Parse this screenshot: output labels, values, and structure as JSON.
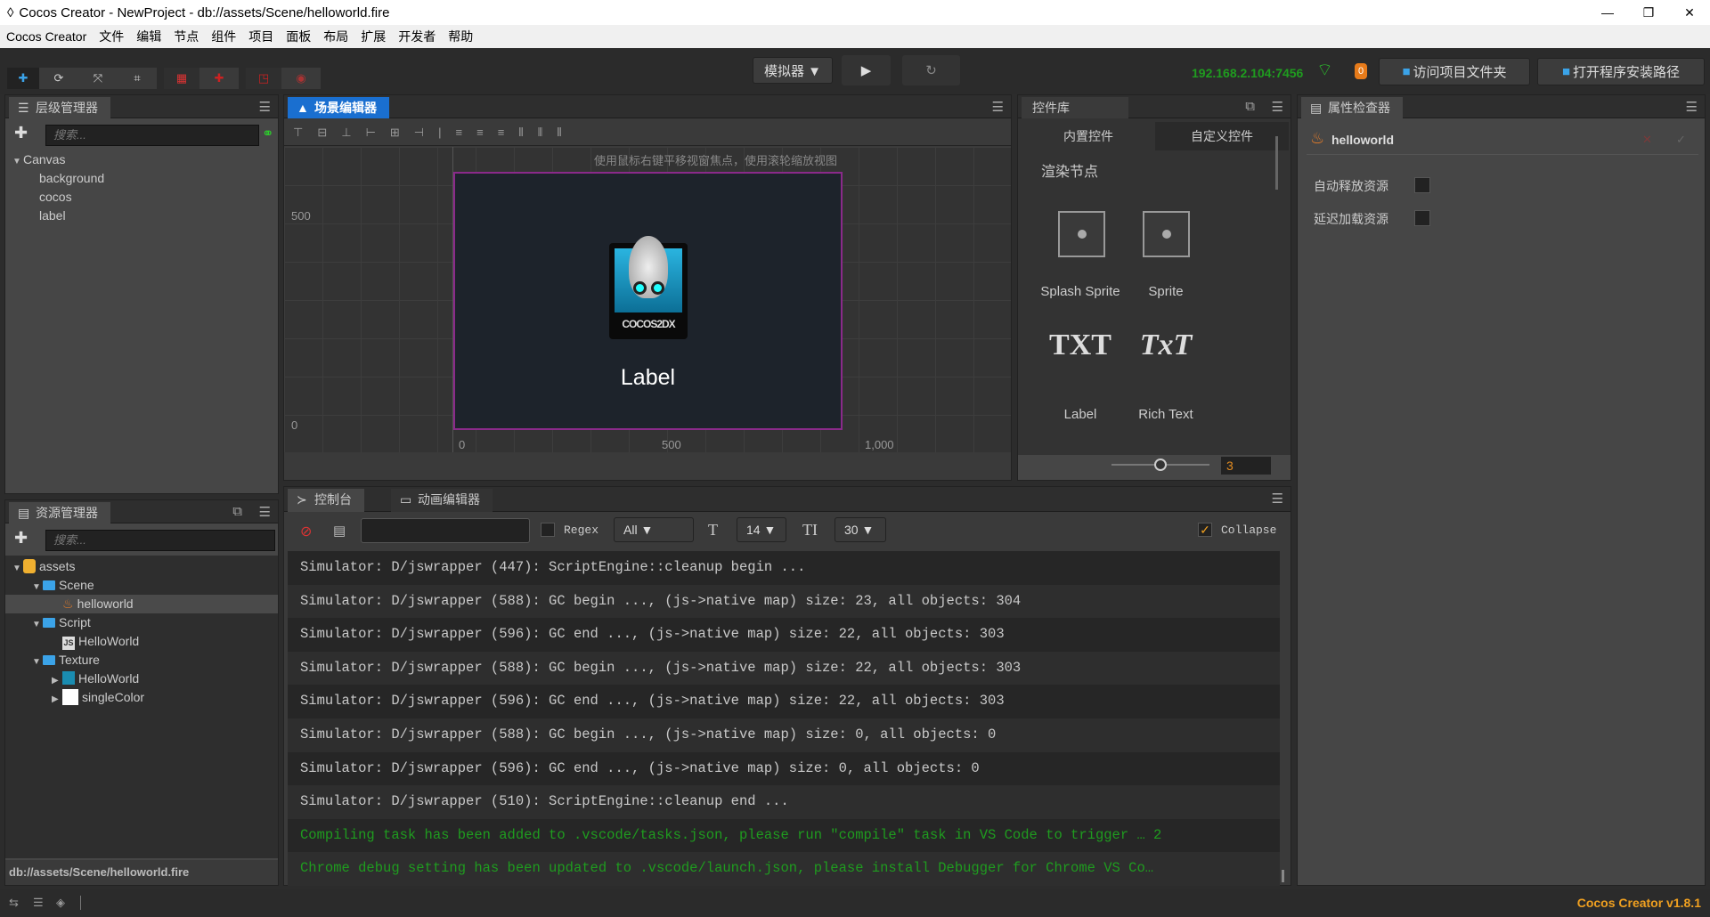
{
  "window": {
    "title": "Cocos Creator - NewProject - db://assets/Scene/helloworld.fire",
    "minimize": "—",
    "maximize": "❐",
    "close": "✕"
  },
  "menu": [
    "Cocos Creator",
    "文件",
    "编辑",
    "节点",
    "组件",
    "项目",
    "面板",
    "布局",
    "扩展",
    "开发者",
    "帮助"
  ],
  "toolbar": {
    "simulator": "模拟器 ▼",
    "play": "▶",
    "refresh": "↻",
    "ip": "192.168.2.104:7456",
    "badge": "0",
    "open_project": "访问项目文件夹",
    "open_install": "打开程序安装路径",
    "accent": "#1f9c1f"
  },
  "hierarchy": {
    "title": "层级管理器",
    "search_placeholder": "搜索...",
    "root": "Canvas",
    "children": [
      "background",
      "cocos",
      "label"
    ]
  },
  "assets": {
    "title": "资源管理器",
    "search_placeholder": "搜索...",
    "tree": [
      {
        "label": "assets",
        "depth": 0,
        "type": "db",
        "arrow": "▼"
      },
      {
        "label": "Scene",
        "depth": 1,
        "type": "folder",
        "arrow": "▼"
      },
      {
        "label": "helloworld",
        "depth": 2,
        "type": "fire",
        "arrow": "",
        "selected": true
      },
      {
        "label": "Script",
        "depth": 1,
        "type": "folder",
        "arrow": "▼"
      },
      {
        "label": "HelloWorld",
        "depth": 2,
        "type": "js",
        "arrow": ""
      },
      {
        "label": "Texture",
        "depth": 1,
        "type": "folder",
        "arrow": "▼"
      },
      {
        "label": "HelloWorld",
        "depth": 2,
        "type": "image",
        "arrow": "▶"
      },
      {
        "label": "singleColor",
        "depth": 2,
        "type": "white",
        "arrow": "▶"
      }
    ],
    "path": "db://assets/Scene/helloworld.fire"
  },
  "scene": {
    "title": "场景编辑器",
    "hint": "使用鼠标右键平移视窗焦点，使用滚轮缩放视图",
    "y_ticks": [
      "500",
      "0"
    ],
    "x_ticks": [
      "0",
      "500",
      "1,000"
    ],
    "label_text": "Label",
    "logo_text": "COCOS2DX",
    "frame_color": "#8a2a8a"
  },
  "library": {
    "title": "控件库",
    "tabs": [
      "内置控件",
      "自定义控件"
    ],
    "section": "渲染节点",
    "items": [
      {
        "label": "Splash Sprite",
        "icon": "sprite-icon"
      },
      {
        "label": "Sprite",
        "icon": "sprite-icon"
      },
      {
        "label": "Label",
        "icon_text": "TXT"
      },
      {
        "label": "Rich Text",
        "icon_text": "TxT"
      }
    ],
    "size_value": "3"
  },
  "inspector": {
    "title": "属性检查器",
    "asset": "helloworld",
    "fields": [
      {
        "label": "自动释放资源",
        "checked": false
      },
      {
        "label": "延迟加载资源",
        "checked": false
      }
    ]
  },
  "console": {
    "tabs": [
      "控制台",
      "动画编辑器"
    ],
    "regex_label": "Regex",
    "filter": "All ▼",
    "font_size": "14 ▼",
    "line_height": "30 ▼",
    "collapse_label": "Collapse",
    "collapse_checked": true,
    "logs": [
      {
        "text": "Simulator: D/jswrapper (447): ScriptEngine::cleanup begin ...",
        "level": "log"
      },
      {
        "text": "Simulator: D/jswrapper (588): GC begin ..., (js->native map) size: 23, all objects: 304",
        "level": "log"
      },
      {
        "text": "Simulator: D/jswrapper (596): GC end ..., (js->native map) size: 22, all objects: 303",
        "level": "log"
      },
      {
        "text": "Simulator: D/jswrapper (588): GC begin ..., (js->native map) size: 22, all objects: 303",
        "level": "log"
      },
      {
        "text": "Simulator: D/jswrapper (596): GC end ..., (js->native map) size: 22, all objects: 303",
        "level": "log"
      },
      {
        "text": "Simulator: D/jswrapper (588): GC begin ..., (js->native map) size: 0, all objects: 0",
        "level": "log"
      },
      {
        "text": "Simulator: D/jswrapper (596): GC end ..., (js->native map) size: 0, all objects: 0",
        "level": "log"
      },
      {
        "text": "Simulator: D/jswrapper (510): ScriptEngine::cleanup end ...",
        "level": "log"
      },
      {
        "text": "Compiling task has been added to .vscode/tasks.json, please run \"compile\" task in VS Code to trigger … 2",
        "level": "info"
      },
      {
        "text": "Chrome debug setting has been updated to .vscode/launch.json, please install Debugger for Chrome VS Co…",
        "level": "info"
      }
    ]
  },
  "statusbar": {
    "version": "Cocos Creator v1.8.1",
    "version_color": "#f0a020"
  }
}
